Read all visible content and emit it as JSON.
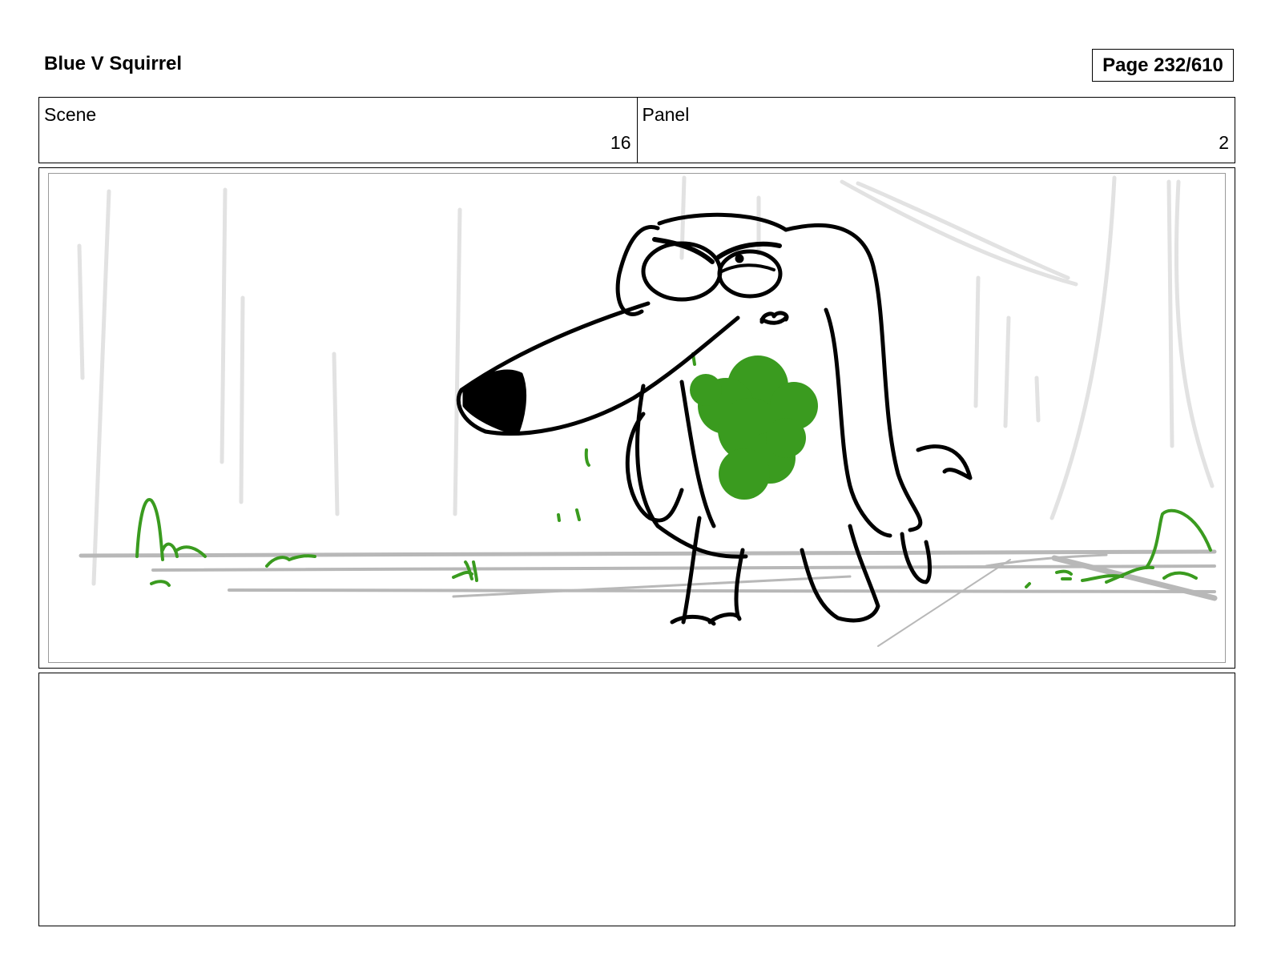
{
  "header": {
    "title": "Blue V Squirrel",
    "page_label": "Page 232/610"
  },
  "scene": {
    "label": "Scene",
    "value": "16"
  },
  "panel": {
    "label": "Panel",
    "value": "2"
  },
  "drawing": {
    "subject": "dog-sketch",
    "line_color": "#000000",
    "grass_color": "#3a9b1f",
    "tree_color": "#e2e2e2",
    "ground_color": "#b8b8b8"
  },
  "notes": {
    "text": ""
  }
}
